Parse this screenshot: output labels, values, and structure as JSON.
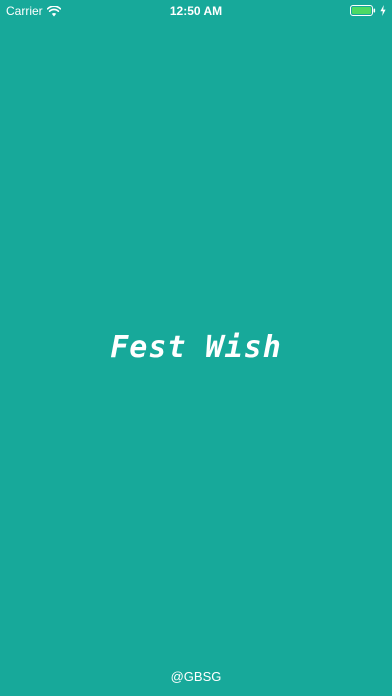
{
  "status_bar": {
    "carrier": "Carrier",
    "time": "12:50 AM",
    "wifi_icon": "wifi-icon",
    "battery_icon": "battery-icon",
    "charging_icon": "charging-bolt-icon",
    "battery_level": 1.0,
    "battery_color": "#4cd964"
  },
  "splash": {
    "title": "Fest Wish",
    "credit": "@GBSG",
    "background_color": "#17a99a"
  }
}
